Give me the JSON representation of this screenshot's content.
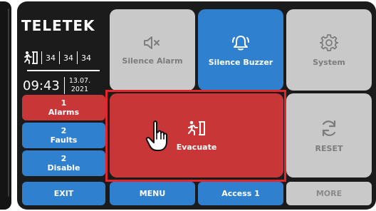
{
  "brand": {
    "name": "TELETEK"
  },
  "status": {
    "zone_counts": [
      "34",
      "34",
      "34"
    ]
  },
  "clock": {
    "time": "09:43",
    "date_day_month": "13.07.",
    "date_year": "2021"
  },
  "side_buttons": {
    "alarms": {
      "count": "1",
      "label": "Alarms"
    },
    "faults": {
      "count": "2",
      "label": "Faults"
    },
    "disable": {
      "count": "2",
      "label": "Disable"
    }
  },
  "tiles": {
    "silence_alarm": "Silence Alarm",
    "silence_buzzer": "Silence Buzzer",
    "system": "System",
    "evacuate": "Evacuate",
    "reset": "RESET"
  },
  "bottom_bar": {
    "exit": "EXIT",
    "menu": "MENU",
    "access": "Access 1",
    "more": "MORE"
  },
  "colors": {
    "accent_blue": "#2f80cf",
    "alarm_red": "#c93638",
    "disabled_gray": "#c9c9c9",
    "panel_dark": "#1b1b1b",
    "highlight_red": "#e3262a"
  },
  "icons": {
    "status_row": "evacuation-running-man-icon",
    "silence_alarm": "speaker-muted-icon",
    "silence_buzzer": "bell-ringing-icon",
    "system": "gear-icon",
    "evacuate": "evacuation-running-man-icon",
    "reset": "refresh-icon",
    "cursor": "hand-pointer-icon"
  }
}
